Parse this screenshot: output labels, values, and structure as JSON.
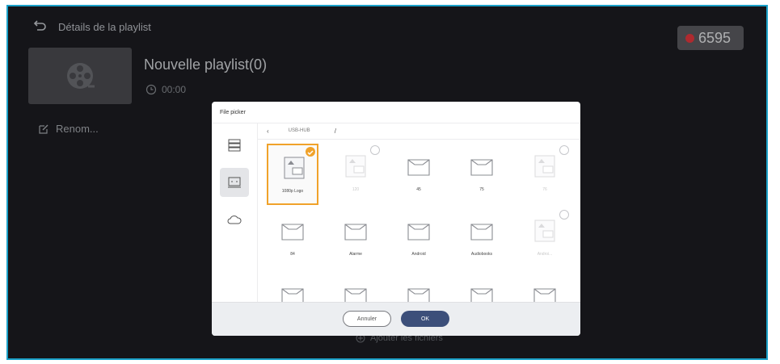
{
  "header": {
    "title": "Détails de la playlist",
    "rec_code": "6595"
  },
  "playlist": {
    "title": "Nouvelle playlist(0)",
    "duration": "00:00",
    "rename_label": "Renom...",
    "add_files_label": "Ajouter les fichiers"
  },
  "picker": {
    "title": "File picker",
    "path_device": "USB-HUB",
    "path_sep": "/",
    "sidebar": [
      {
        "name": "storage-icon"
      },
      {
        "name": "device-icon"
      },
      {
        "name": "cloud-icon"
      }
    ],
    "files": [
      {
        "label": "1080p Logo",
        "type": "image",
        "selected": true,
        "dim": false,
        "check": true
      },
      {
        "label": "120",
        "type": "image",
        "selected": false,
        "dim": true,
        "check": true
      },
      {
        "label": "45",
        "type": "folder",
        "selected": false,
        "dim": false,
        "check": false
      },
      {
        "label": "75",
        "type": "folder",
        "selected": false,
        "dim": false,
        "check": false
      },
      {
        "label": "76",
        "type": "image",
        "selected": false,
        "dim": true,
        "check": true
      },
      {
        "label": "84",
        "type": "folder",
        "selected": false,
        "dim": false,
        "check": false
      },
      {
        "label": "Alarme",
        "type": "folder",
        "selected": false,
        "dim": false,
        "check": false
      },
      {
        "label": "Android",
        "type": "folder",
        "selected": false,
        "dim": false,
        "check": false
      },
      {
        "label": "Audiobooks",
        "type": "folder",
        "selected": false,
        "dim": false,
        "check": false
      },
      {
        "label": "Androi...",
        "type": "image",
        "selected": false,
        "dim": true,
        "check": true
      },
      {
        "label": "",
        "type": "folder",
        "selected": false,
        "dim": false,
        "check": false
      },
      {
        "label": "",
        "type": "folder",
        "selected": false,
        "dim": false,
        "check": false
      },
      {
        "label": "",
        "type": "folder",
        "selected": false,
        "dim": false,
        "check": false
      },
      {
        "label": "",
        "type": "folder",
        "selected": false,
        "dim": false,
        "check": false
      },
      {
        "label": "",
        "type": "folder",
        "selected": false,
        "dim": false,
        "check": false
      }
    ],
    "cancel_label": "Annuler",
    "ok_label": "OK"
  },
  "colors": {
    "accent": "#f0a22a",
    "frame": "#1aa0c8",
    "ok_button": "#3c4f7a",
    "record": "#e8393f"
  }
}
